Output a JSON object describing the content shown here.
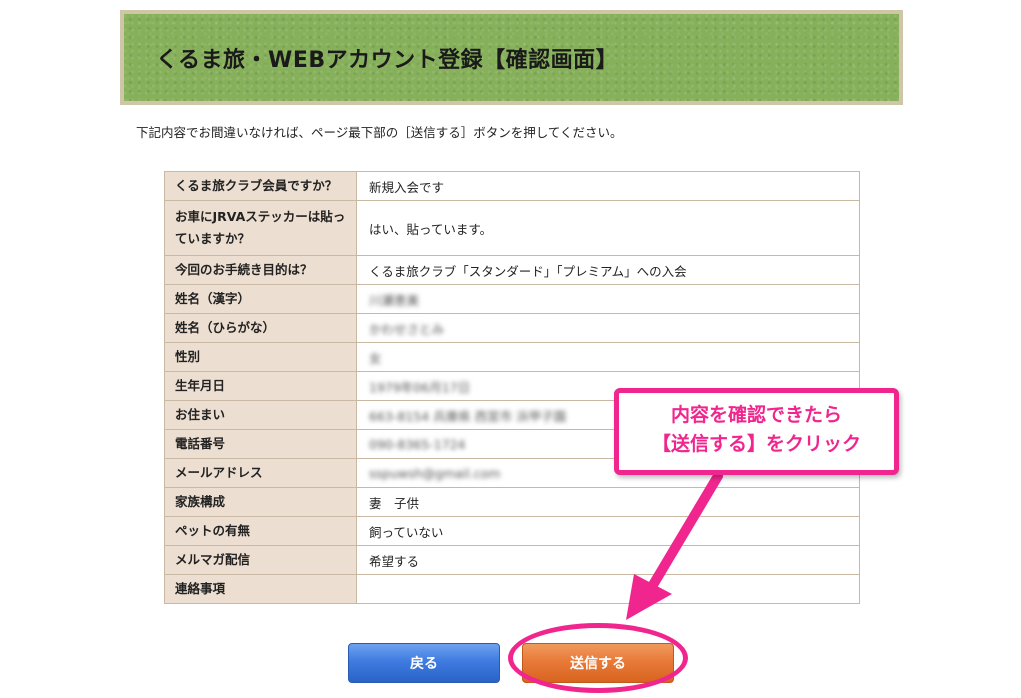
{
  "header": {
    "title": "くるま旅・WEBアカウント登録【確認画面】"
  },
  "instruction": "下記内容でお間違いなければ、ページ最下部の［送信する］ボタンを押してください。",
  "rows": [
    {
      "label": "くるま旅クラブ会員ですか？",
      "value": "新規入会です"
    },
    {
      "label": "お車にJRVAステッカーは貼っていますか？",
      "value": "はい、貼っています。"
    },
    {
      "label": "今回のお手続き目的は？",
      "value": "くるま旅クラブ「スタンダード」「プレミアム」への入会"
    },
    {
      "label": "姓名（漢字）",
      "value": "川瀬恵美"
    },
    {
      "label": "姓名（ひらがな）",
      "value": "かわせさとみ"
    },
    {
      "label": "性別",
      "value": "女"
    },
    {
      "label": "生年月日",
      "value": "1979年06月17日"
    },
    {
      "label": "お住まい",
      "value": "663-8154 兵庫県 西宮市 浜甲子園"
    },
    {
      "label": "電話番号",
      "value": "090-8365-1724"
    },
    {
      "label": "メールアドレス",
      "value": "sspuwsh@gmail.com"
    },
    {
      "label": "家族構成",
      "value": "妻　子供"
    },
    {
      "label": "ペットの有無",
      "value": "飼っていない"
    },
    {
      "label": "メルマガ配信",
      "value": "希望する"
    },
    {
      "label": "連絡事項",
      "value": ""
    }
  ],
  "buttons": {
    "back": "戻る",
    "submit": "送信する"
  },
  "callout": {
    "line1": "内容を確認できたら",
    "line2": "【送信する】をクリック"
  },
  "colors": {
    "annotation": "#f0268e",
    "header_green": "#86b05a",
    "label_bg": "#ecded0",
    "back_button": "#3f7be0",
    "submit_button": "#e87a38"
  }
}
